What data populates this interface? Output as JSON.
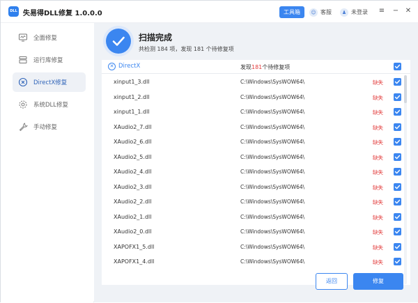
{
  "app": {
    "logo_text": "DLL",
    "title": "失易得DLL修复 1.0.0.0",
    "toolbox_label": "工具箱",
    "support_label": "客服",
    "login_label": "未登录"
  },
  "sidebar": {
    "items": [
      {
        "label": "全面修复",
        "icon": "monitor-icon",
        "active": false
      },
      {
        "label": "运行库修复",
        "icon": "stack-icon",
        "active": false
      },
      {
        "label": "DirectX修复",
        "icon": "x-circle-icon",
        "active": true
      },
      {
        "label": "系统DLL修复",
        "icon": "gear-icon",
        "active": false
      },
      {
        "label": "手动修复",
        "icon": "wrench-icon",
        "active": false
      }
    ]
  },
  "scan": {
    "title": "扫描完成",
    "summary": "共检测 184 项，发现 181 个待修复项"
  },
  "list": {
    "category": "DirectX",
    "found_prefix": "发现",
    "found_count": "181",
    "found_suffix": "个待修复项",
    "status_missing": "缺失",
    "rows": [
      {
        "file": "xinput1_3.dll",
        "path": "C:\\Windows\\SysWOW64\\"
      },
      {
        "file": "xinput1_2.dll",
        "path": "C:\\Windows\\SysWOW64\\"
      },
      {
        "file": "xinput1_1.dll",
        "path": "C:\\Windows\\SysWOW64\\"
      },
      {
        "file": "XAudio2_7.dll",
        "path": "C:\\Windows\\SysWOW64\\"
      },
      {
        "file": "XAudio2_6.dll",
        "path": "C:\\Windows\\SysWOW64\\"
      },
      {
        "file": "XAudio2_5.dll",
        "path": "C:\\Windows\\SysWOW64\\"
      },
      {
        "file": "XAudio2_4.dll",
        "path": "C:\\Windows\\SysWOW64\\"
      },
      {
        "file": "XAudio2_3.dll",
        "path": "C:\\Windows\\SysWOW64\\"
      },
      {
        "file": "XAudio2_2.dll",
        "path": "C:\\Windows\\SysWOW64\\"
      },
      {
        "file": "XAudio2_1.dll",
        "path": "C:\\Windows\\SysWOW64\\"
      },
      {
        "file": "XAudio2_0.dll",
        "path": "C:\\Windows\\SysWOW64\\"
      },
      {
        "file": "XAPOFX1_5.dll",
        "path": "C:\\Windows\\SysWOW64\\"
      },
      {
        "file": "XAPOFX1_4.dll",
        "path": "C:\\Windows\\SysWOW64\\"
      }
    ]
  },
  "buttons": {
    "back_label": "返回",
    "repair_label": "修复"
  },
  "colors": {
    "accent": "#3b86f0",
    "missing": "#e23b3b"
  }
}
